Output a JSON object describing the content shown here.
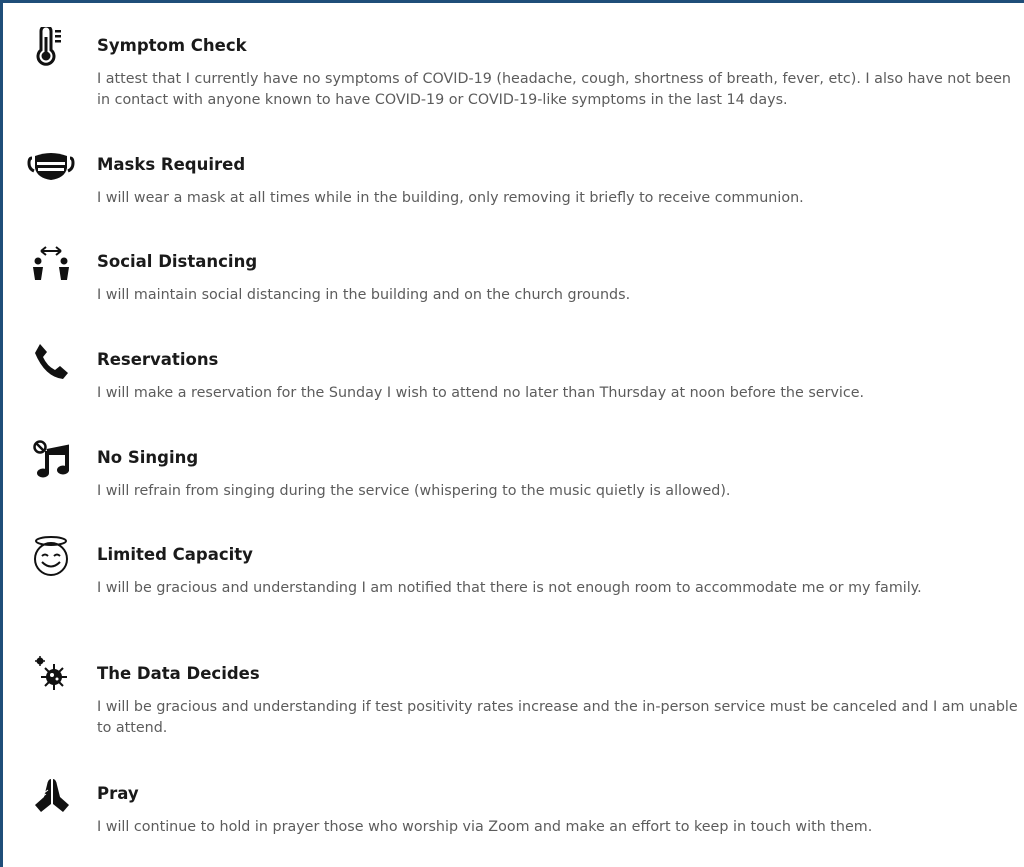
{
  "items": [
    {
      "icon": "thermometer-icon",
      "title": "Symptom Check",
      "description": "I attest that I currently have no symptoms of COVID-19 (headache, cough, shortness of breath, fever, etc). I also have not been in contact with anyone known to have COVID-19 or COVID-19-like symptoms in the last 14 days."
    },
    {
      "icon": "mask-icon",
      "title": "Masks Required",
      "description": "I will wear a mask at all times while in the building, only removing it briefly to receive communion."
    },
    {
      "icon": "social-distancing-icon",
      "title": "Social Distancing",
      "description": "I will maintain social distancing in the building and on the church grounds."
    },
    {
      "icon": "phone-icon",
      "title": "Reservations",
      "description": "I will make a reservation for the Sunday I wish to attend no later than Thursday at noon before the service."
    },
    {
      "icon": "no-music-icon",
      "title": "No Singing",
      "description": "I will refrain from singing during the service (whispering to the music quietly is allowed)."
    },
    {
      "icon": "halo-smile-icon",
      "title": "Limited Capacity",
      "description": "I will be gracious and understanding I am notified that there is not enough room to accommodate me or my family."
    },
    {
      "icon": "virus-icon",
      "title": "The Data Decides",
      "description": "I will be gracious and understanding if test positivity rates increase and the in-person service must be canceled and I am unable to attend."
    },
    {
      "icon": "praying-hands-icon",
      "title": "Pray",
      "description": "I will continue to hold in prayer those who worship via Zoom and make an effort to keep in touch with them."
    }
  ]
}
